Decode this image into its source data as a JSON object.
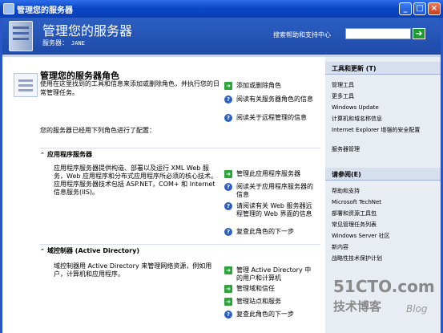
{
  "window": {
    "title": "管理您的服务器"
  },
  "header": {
    "title": "管理您的服务器",
    "server_label": "服务器：",
    "server_name": "JANE",
    "search_label": "搜索帮助和支持中心",
    "search_value": ""
  },
  "main": {
    "title": "管理您的服务器角色",
    "description": "使用在这里找到的工具和信息来添加或删除角色，并执行您的日常管理任务。",
    "intro": "您的服务器已经用下列角色进行了配置：",
    "top_links": [
      "添加或删除角色",
      "阅读有关服务器角色的信息",
      "阅读关于远程管理的信息"
    ],
    "sections": [
      {
        "title": "应用程序服务器",
        "description": "应用程序服务器提供构造、部署以及运行 XML Web 服务，Web 应用程序和分布式应用程序所必须的核心技术。应用程序服务器技术包括 ASP.NET，COM+ 和 Internet 信息服务(IIS)。",
        "links": [
          "管理此应用程序服务器",
          "阅读关于应用程序服务器的信息",
          "请阅读有关 Web 服务器远程管理的 Web 界面的信息",
          "复查此角色的下一步"
        ]
      },
      {
        "title": "域控制器 (Active Directory)",
        "description": "域控制器用 Active Directory 来管理网络资源，例如用户，计算机和应用程序。",
        "links": [
          "管理 Active Directory 中的用户和计算机",
          "管理域和信任",
          "管理站点和服务",
          "复查此角色的下一步"
        ]
      }
    ]
  },
  "sidebar": {
    "tools": {
      "title": "工具和更新 (T)",
      "items": [
        "管理工具",
        "更多工具",
        "Windows Update",
        "计算机和域名称信息",
        "Internet Explorer 增强的安全配置",
        "服务器管理"
      ]
    },
    "see_also": {
      "title": "请参阅(E)",
      "items": [
        "帮助和支持",
        "Microsoft TechNet",
        "部署和资源工具包",
        "常见管理任务列表",
        "Windows Server 社区",
        "新内容",
        "战略性技术保护计划"
      ]
    }
  },
  "watermark": {
    "site": "51CTO.com",
    "text": "技术博客",
    "blog": "Blog"
  },
  "colors": {
    "titlebar": "#0b48c7",
    "header": "#2c5fc3",
    "sidebar": "#e8ecf3",
    "go_icon": "#2aa63b",
    "help_icon": "#2b5fc8"
  }
}
